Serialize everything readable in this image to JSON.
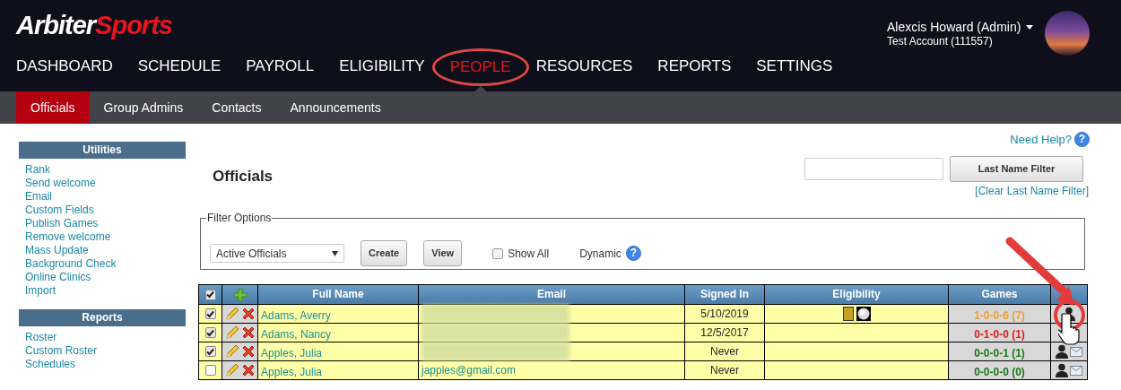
{
  "header": {
    "logo": {
      "first": "Arbiter",
      "second": "Sports"
    },
    "user": {
      "name": "Alexcis Howard (Admin)",
      "account": "Test Account (111557)"
    },
    "nav": [
      {
        "label": "DASHBOARD",
        "selected": false
      },
      {
        "label": "SCHEDULE",
        "selected": false
      },
      {
        "label": "PAYROLL",
        "selected": false
      },
      {
        "label": "ELIGIBILITY",
        "selected": false
      },
      {
        "label": "PEOPLE",
        "selected": true
      },
      {
        "label": "RESOURCES",
        "selected": false
      },
      {
        "label": "REPORTS",
        "selected": false
      },
      {
        "label": "SETTINGS",
        "selected": false
      }
    ],
    "subnav": [
      {
        "label": "Officials",
        "selected": true
      },
      {
        "label": "Group Admins",
        "selected": false
      },
      {
        "label": "Contacts",
        "selected": false
      },
      {
        "label": "Announcements",
        "selected": false
      }
    ]
  },
  "sidebar": [
    {
      "title": "Utilities",
      "links": [
        "Rank",
        "Send welcome",
        "Email",
        "Custom Fields",
        "Publish Games",
        "Remove welcome",
        "Mass Update",
        "Background Check",
        "Online Clinics",
        "Import"
      ]
    },
    {
      "title": "Reports",
      "links": [
        "Roster",
        "Custom Roster",
        "Schedules"
      ]
    }
  ],
  "main": {
    "title": "Officials",
    "help_link": "Need Help?",
    "help_icon": "?",
    "filter_button": "Last Name Filter",
    "clear_link": "[Clear Last Name Filter]",
    "filter_options": {
      "legend": "Filter Options",
      "select": "Active Officials",
      "buttons": [
        "Create",
        "View"
      ],
      "show_all": {
        "label": "Show All",
        "checked": false
      },
      "dynamic": "Dynamic",
      "dynamic_icon": "?"
    },
    "table": {
      "header_checked": true,
      "columns": [
        "Full Name",
        "Email",
        "Signed In",
        "Eligibility",
        "Games"
      ],
      "rows": [
        {
          "checked": true,
          "name": "Adams, Averry",
          "email_blurred": true,
          "signed_in": "5/10/2019",
          "eligibility_icons": true,
          "games": "1-0-0-6 (7)",
          "color": "#f0a030",
          "envelope": false
        },
        {
          "checked": true,
          "name": "Adams, Nancy",
          "email_blurred": true,
          "signed_in": "12/5/2017",
          "eligibility_icons": false,
          "games": "0-1-0-0 (1)",
          "color": "#e02020",
          "envelope": false
        },
        {
          "checked": true,
          "name": "Apples, Julia",
          "email_blurred": true,
          "signed_in": "Never",
          "eligibility_icons": false,
          "games": "0-0-0-1 (1)",
          "color": "#1a7a1a",
          "envelope": true
        },
        {
          "checked": false,
          "name": "Apples, Julia",
          "email": "japples@gmail.com",
          "email_blurred": false,
          "signed_in": "Never",
          "eligibility_icons": false,
          "games": "0-0-0-0 (0)",
          "color": "#1a7a1a",
          "envelope": true
        }
      ]
    }
  }
}
